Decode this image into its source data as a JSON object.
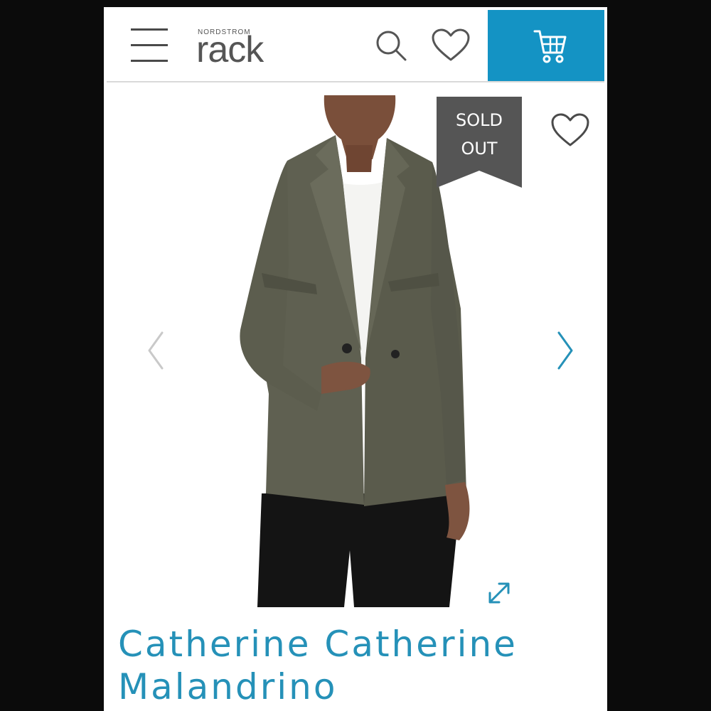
{
  "header": {
    "logo_small": "NORDSTROM",
    "logo_main": "rack",
    "menu_icon": "hamburger-menu-icon",
    "search_icon": "search-icon",
    "wishlist_icon": "heart-icon",
    "cart_icon": "cart-icon",
    "cart_color": "#1493c4"
  },
  "product": {
    "badge_line1": "SOLD",
    "badge_line2": "OUT",
    "badge_color": "#555555",
    "title": "Catherine Catherine Malandrino",
    "title_color": "#2591b8",
    "favorite_icon": "heart-outline-icon",
    "expand_icon": "expand-arrows-icon",
    "prev_icon": "chevron-left-icon",
    "next_icon": "chevron-right-icon"
  }
}
